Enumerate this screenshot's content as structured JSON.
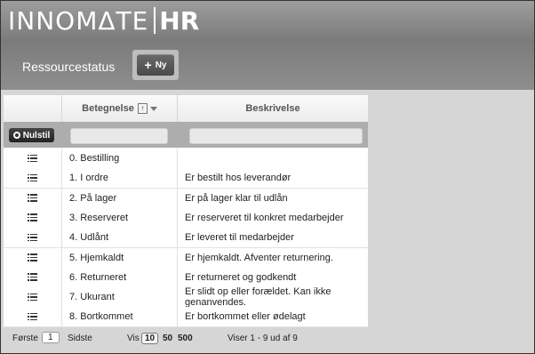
{
  "header": {
    "logo_main": "INNOMΔTE",
    "logo_hr": "HR"
  },
  "toolbar": {
    "title": "Ressourcestatus",
    "new_label": "Ny"
  },
  "table": {
    "columns": [
      {
        "label": "Betegnelse",
        "sort": "asc"
      },
      {
        "label": "Beskrivelse"
      }
    ],
    "reset_label": "Nulstil",
    "rows": [
      {
        "name": "0. Bestilling",
        "description": ""
      },
      {
        "name": "1. I ordre",
        "description": "Er bestilt hos leverandør"
      },
      {
        "name": "2. På lager",
        "description": "Er på lager klar til udlån"
      },
      {
        "name": "3. Reserveret",
        "description": "Er reserveret til konkret medarbejder"
      },
      {
        "name": "4. Udlånt",
        "description": "Er leveret til medarbejder"
      },
      {
        "name": "5. Hjemkaldt",
        "description": "Er hjemkaldt. Afventer returnering."
      },
      {
        "name": "6. Returneret",
        "description": "Er returneret og godkendt"
      },
      {
        "name": "7. Ukurant",
        "description": "Er slidt op eller forældet. Kan ikke genanvendes."
      },
      {
        "name": "8. Bortkommet",
        "description": "Er bortkommet eller ødelagt"
      }
    ]
  },
  "pagination": {
    "first_label": "Første",
    "current_page": "1",
    "last_label": "Sidste",
    "show_label": "Vis",
    "page_sizes": [
      "10",
      "50",
      "500"
    ],
    "summary": "Viser 1 - 9 ud af 9"
  }
}
